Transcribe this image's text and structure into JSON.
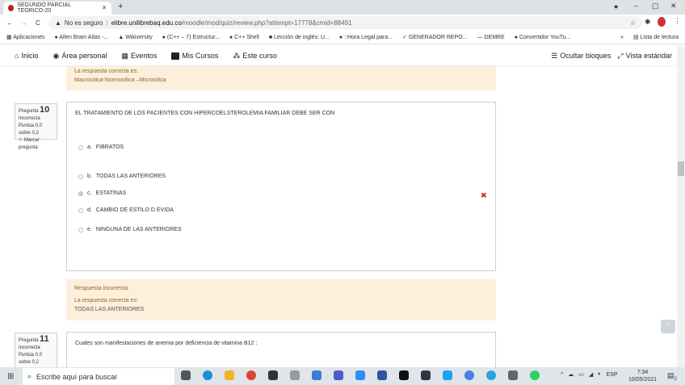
{
  "browser": {
    "tab_title": "SEGUNDO PARCIAL TEORICO-20",
    "not_secure": "No es seguro",
    "url_host": "elibre.unilibrebaq.edu.co",
    "url_path": "/moodle/mod/quiz/review.php?attempt=17778&cmid=88491",
    "bookmarks": [
      "Aplicaciones",
      "Allen Brain Atlas -...",
      "Wikiversity",
      "(C++ – 7) Estructur...",
      "C++ Shell",
      "Lección de inglés: U...",
      "::Hora Legal para...",
      "GENERADOR REPO...",
      "DEMRE",
      "Convertidor YouTu..."
    ],
    "reading_list": "Lista de lectura"
  },
  "nav": {
    "items": [
      "Inicio",
      "Área personal",
      "Eventos",
      "Mis Cursos",
      "Este curso"
    ],
    "hide_blocks": "Ocultar bloques",
    "standard_view": "Vista estándar"
  },
  "prev_feedback": {
    "label": "La respuesta correcta es:",
    "answer": "Macrocitica-Normocitica –Microcitica"
  },
  "q10": {
    "label": "Pregunta",
    "number": "10",
    "state": "Incorrecta",
    "score": "Puntúa 0,0 sobre 0,2",
    "flag": "Marcar pregunta",
    "text": "EL TRATAMIENTO DE LOS   PACIENTES   CON  HIPERCOELSTEROLEMIA FAMILIAR DEBE SER  CON",
    "options": [
      {
        "letter": "a.",
        "text": "FIBRATOS"
      },
      {
        "letter": "b.",
        "text": "TODAS  LAS ANTERIORES"
      },
      {
        "letter": "c.",
        "text": "ESTATINAS"
      },
      {
        "letter": "d.",
        "text": "CAMBIO DE  ESTILO D EVIDA"
      },
      {
        "letter": "e.",
        "text": "NINGUNA  DE  LAS ANTERIORES"
      }
    ],
    "selected": "c.",
    "feedback": {
      "status": "Respuesta incorrecta.",
      "label": "La respuesta correcta es:",
      "answer": "TODAS  LAS ANTERIORES"
    }
  },
  "q11": {
    "label": "Pregunta",
    "number": "11",
    "state": "Incorrecta",
    "score": "Puntúa 0,0 sobre 0,2",
    "text": "Cuales son manifestaciones de  anemia por deficiencia de vitamina B12  :"
  },
  "taskbar": {
    "search_placeholder": "Escribe aquí para buscar",
    "lang": "ESP",
    "time": "7:34",
    "date": "10/05/2021",
    "notifications": "2"
  }
}
